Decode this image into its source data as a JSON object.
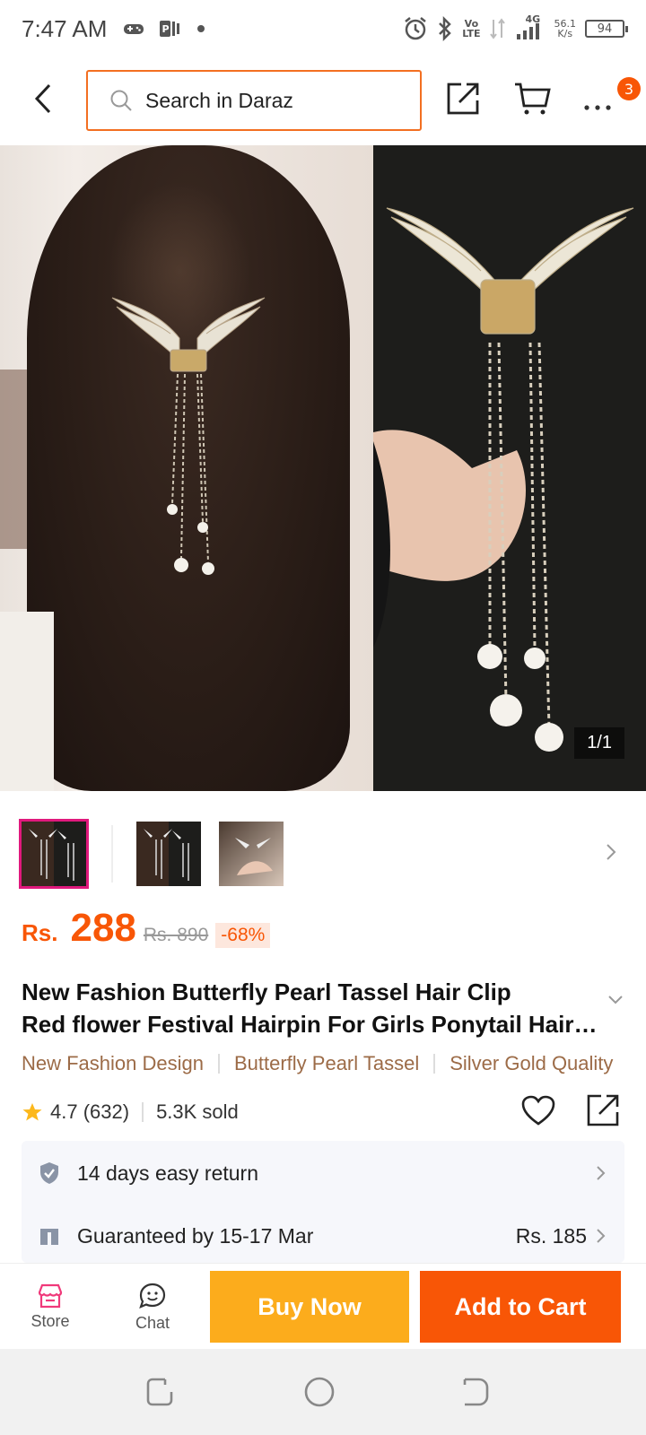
{
  "status_bar": {
    "time": "7:47 AM",
    "volte": "Vo",
    "lte": "LTE",
    "network": "4G",
    "speed_value": "56.1",
    "speed_unit": "K/s",
    "battery": "94",
    "icons": [
      "gamepad-icon",
      "p-app-icon",
      "dot-icon",
      "alarm-icon",
      "bluetooth-icon",
      "signal-icon"
    ]
  },
  "header": {
    "search_placeholder": "Search in Daraz",
    "cart_badge": "3",
    "accent": "#f36f21"
  },
  "gallery": {
    "page_indicator": "1/1",
    "thumbnail_count": 3,
    "selected_index": 0
  },
  "price": {
    "currency": "Rs.",
    "current": "288",
    "original": "Rs. 890",
    "discount": "-68%",
    "color": "#f85606"
  },
  "product": {
    "title_line1": "New Fashion Butterfly Pearl Tassel Hair Clip",
    "title_line2": "Red flower Festival Hairpin For Girls Ponytail Hairpin",
    "tags": [
      "New Fashion Design",
      "Butterfly Pearl Tassel",
      "Silver Gold Quality"
    ],
    "rating": "4.7 (632)",
    "sold": "5.3K sold"
  },
  "services": {
    "return_text": "14 days easy return",
    "delivery_text": "Guaranteed by 15-17 Mar",
    "delivery_fee": "Rs. 185"
  },
  "bottom_bar": {
    "store_label": "Store",
    "chat_label": "Chat",
    "buy_now": "Buy Now",
    "add_to_cart": "Add to Cart",
    "buy_color": "#fcac1c",
    "cart_color": "#f85606"
  }
}
